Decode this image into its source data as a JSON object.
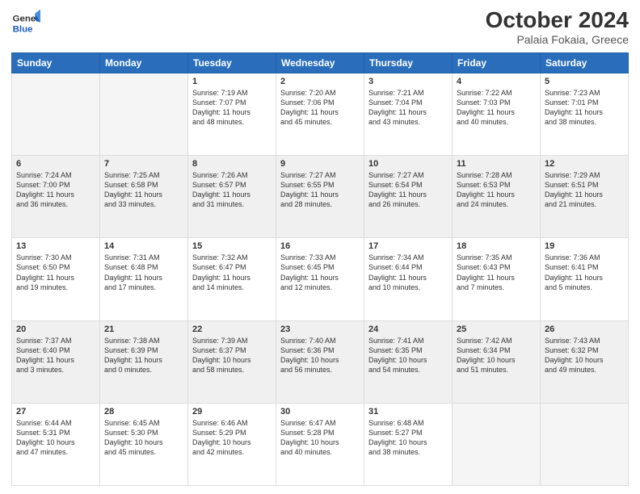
{
  "header": {
    "logo_line1": "General",
    "logo_line2": "Blue",
    "title": "October 2024",
    "subtitle": "Palaia Fokaia, Greece"
  },
  "days_of_week": [
    "Sunday",
    "Monday",
    "Tuesday",
    "Wednesday",
    "Thursday",
    "Friday",
    "Saturday"
  ],
  "weeks": [
    [
      {
        "day": "",
        "info": ""
      },
      {
        "day": "",
        "info": ""
      },
      {
        "day": "1",
        "info": "Sunrise: 7:19 AM\nSunset: 7:07 PM\nDaylight: 11 hours\nand 48 minutes."
      },
      {
        "day": "2",
        "info": "Sunrise: 7:20 AM\nSunset: 7:06 PM\nDaylight: 11 hours\nand 45 minutes."
      },
      {
        "day": "3",
        "info": "Sunrise: 7:21 AM\nSunset: 7:04 PM\nDaylight: 11 hours\nand 43 minutes."
      },
      {
        "day": "4",
        "info": "Sunrise: 7:22 AM\nSunset: 7:03 PM\nDaylight: 11 hours\nand 40 minutes."
      },
      {
        "day": "5",
        "info": "Sunrise: 7:23 AM\nSunset: 7:01 PM\nDaylight: 11 hours\nand 38 minutes."
      }
    ],
    [
      {
        "day": "6",
        "info": "Sunrise: 7:24 AM\nSunset: 7:00 PM\nDaylight: 11 hours\nand 36 minutes."
      },
      {
        "day": "7",
        "info": "Sunrise: 7:25 AM\nSunset: 6:58 PM\nDaylight: 11 hours\nand 33 minutes."
      },
      {
        "day": "8",
        "info": "Sunrise: 7:26 AM\nSunset: 6:57 PM\nDaylight: 11 hours\nand 31 minutes."
      },
      {
        "day": "9",
        "info": "Sunrise: 7:27 AM\nSunset: 6:55 PM\nDaylight: 11 hours\nand 28 minutes."
      },
      {
        "day": "10",
        "info": "Sunrise: 7:27 AM\nSunset: 6:54 PM\nDaylight: 11 hours\nand 26 minutes."
      },
      {
        "day": "11",
        "info": "Sunrise: 7:28 AM\nSunset: 6:53 PM\nDaylight: 11 hours\nand 24 minutes."
      },
      {
        "day": "12",
        "info": "Sunrise: 7:29 AM\nSunset: 6:51 PM\nDaylight: 11 hours\nand 21 minutes."
      }
    ],
    [
      {
        "day": "13",
        "info": "Sunrise: 7:30 AM\nSunset: 6:50 PM\nDaylight: 11 hours\nand 19 minutes."
      },
      {
        "day": "14",
        "info": "Sunrise: 7:31 AM\nSunset: 6:48 PM\nDaylight: 11 hours\nand 17 minutes."
      },
      {
        "day": "15",
        "info": "Sunrise: 7:32 AM\nSunset: 6:47 PM\nDaylight: 11 hours\nand 14 minutes."
      },
      {
        "day": "16",
        "info": "Sunrise: 7:33 AM\nSunset: 6:45 PM\nDaylight: 11 hours\nand 12 minutes."
      },
      {
        "day": "17",
        "info": "Sunrise: 7:34 AM\nSunset: 6:44 PM\nDaylight: 11 hours\nand 10 minutes."
      },
      {
        "day": "18",
        "info": "Sunrise: 7:35 AM\nSunset: 6:43 PM\nDaylight: 11 hours\nand 7 minutes."
      },
      {
        "day": "19",
        "info": "Sunrise: 7:36 AM\nSunset: 6:41 PM\nDaylight: 11 hours\nand 5 minutes."
      }
    ],
    [
      {
        "day": "20",
        "info": "Sunrise: 7:37 AM\nSunset: 6:40 PM\nDaylight: 11 hours\nand 3 minutes."
      },
      {
        "day": "21",
        "info": "Sunrise: 7:38 AM\nSunset: 6:39 PM\nDaylight: 11 hours\nand 0 minutes."
      },
      {
        "day": "22",
        "info": "Sunrise: 7:39 AM\nSunset: 6:37 PM\nDaylight: 10 hours\nand 58 minutes."
      },
      {
        "day": "23",
        "info": "Sunrise: 7:40 AM\nSunset: 6:36 PM\nDaylight: 10 hours\nand 56 minutes."
      },
      {
        "day": "24",
        "info": "Sunrise: 7:41 AM\nSunset: 6:35 PM\nDaylight: 10 hours\nand 54 minutes."
      },
      {
        "day": "25",
        "info": "Sunrise: 7:42 AM\nSunset: 6:34 PM\nDaylight: 10 hours\nand 51 minutes."
      },
      {
        "day": "26",
        "info": "Sunrise: 7:43 AM\nSunset: 6:32 PM\nDaylight: 10 hours\nand 49 minutes."
      }
    ],
    [
      {
        "day": "27",
        "info": "Sunrise: 6:44 AM\nSunset: 5:31 PM\nDaylight: 10 hours\nand 47 minutes."
      },
      {
        "day": "28",
        "info": "Sunrise: 6:45 AM\nSunset: 5:30 PM\nDaylight: 10 hours\nand 45 minutes."
      },
      {
        "day": "29",
        "info": "Sunrise: 6:46 AM\nSunset: 5:29 PM\nDaylight: 10 hours\nand 42 minutes."
      },
      {
        "day": "30",
        "info": "Sunrise: 6:47 AM\nSunset: 5:28 PM\nDaylight: 10 hours\nand 40 minutes."
      },
      {
        "day": "31",
        "info": "Sunrise: 6:48 AM\nSunset: 5:27 PM\nDaylight: 10 hours\nand 38 minutes."
      },
      {
        "day": "",
        "info": ""
      },
      {
        "day": "",
        "info": ""
      }
    ]
  ]
}
